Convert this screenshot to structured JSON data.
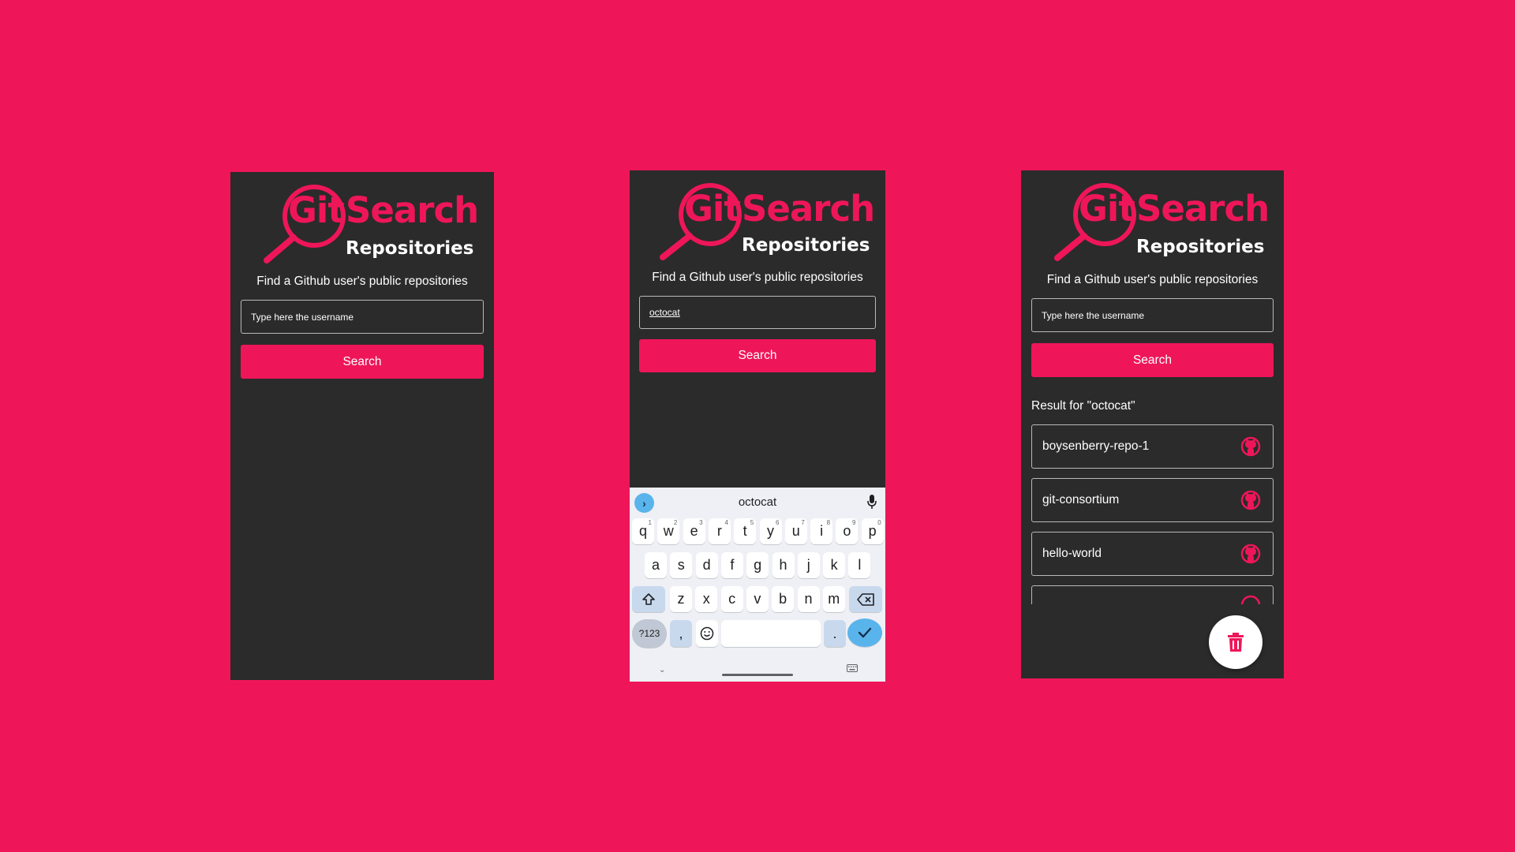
{
  "colors": {
    "accent": "#ee1659",
    "panel": "#2b2b2b",
    "border": "#b9b9b9",
    "keyboard_bg": "#eef0f5",
    "enter_key": "#5ab4ec"
  },
  "logo": {
    "part1": "Git",
    "part2": "Search",
    "subtitle": "Repositories"
  },
  "tagline": "Find a Github user's public repositories",
  "screen1": {
    "input_placeholder": "Type here the username",
    "search_label": "Search"
  },
  "screen2": {
    "input_value": "octocat",
    "search_label": "Search",
    "keyboard": {
      "suggestion": "octocat",
      "row1": [
        "q",
        "w",
        "e",
        "r",
        "t",
        "y",
        "u",
        "i",
        "o",
        "p"
      ],
      "row1_hints": [
        "1",
        "2",
        "3",
        "4",
        "5",
        "6",
        "7",
        "8",
        "9",
        "0"
      ],
      "row2": [
        "a",
        "s",
        "d",
        "f",
        "g",
        "h",
        "j",
        "k",
        "l"
      ],
      "row3": [
        "z",
        "x",
        "c",
        "v",
        "b",
        "n",
        "m"
      ],
      "numbers_key": "?123",
      "comma_key": ",",
      "period_key": "."
    }
  },
  "screen3": {
    "input_placeholder": "Type here the username",
    "search_label": "Search",
    "result_title": "Result for \"octocat\"",
    "repos": [
      "boysenberry-repo-1",
      "git-consortium",
      "hello-world"
    ],
    "repo_icon": "github-icon",
    "fab_icon": "trash-icon"
  }
}
